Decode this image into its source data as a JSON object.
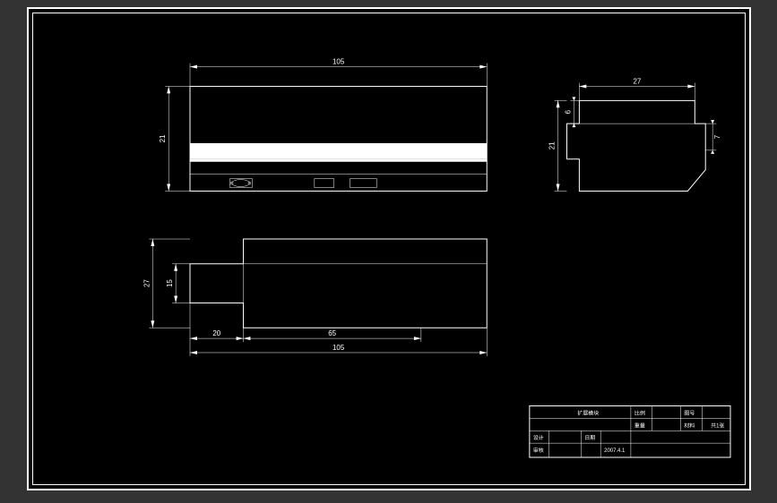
{
  "dimensions": {
    "front_width": "105",
    "front_height": "21",
    "top_width_full": "105",
    "top_width_mid": "65",
    "top_width_step": "20",
    "top_height": "27",
    "top_step_height": "15",
    "side_width": "27",
    "side_height": "21",
    "side_step_h": "6",
    "side_step_w": "7"
  },
  "title_block": {
    "name": "扩展模块",
    "rows": {
      "design_label": "设计",
      "check_label": "审核",
      "date_label": "日期",
      "date_value": "2007.4.1",
      "scale_label": "比例",
      "weight_label": "重量",
      "sheet_label": "图号",
      "material_label": "材料",
      "sheet_count": "共1张"
    }
  }
}
